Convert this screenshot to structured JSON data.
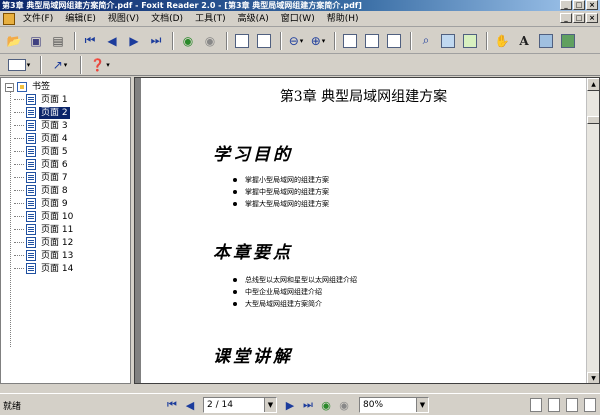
{
  "window": {
    "title": "第3章  典型局域网组建方案简介.pdf - Foxit Reader 2.0 - [第3章  典型局域网组建方案简介.pdf]",
    "btn_min": "_",
    "btn_max": "□",
    "btn_close": "×"
  },
  "menu": {
    "items": [
      "文件(F)",
      "编辑(E)",
      "视图(V)",
      "文档(D)",
      "工具(T)",
      "高级(A)",
      "窗口(W)",
      "帮助(H)"
    ]
  },
  "sidebar": {
    "root_label": "书签",
    "toggle": "−",
    "items": [
      "页面 1",
      "页面 2",
      "页面 3",
      "页面 4",
      "页面 5",
      "页面 6",
      "页面 7",
      "页面 8",
      "页面 9",
      "页面 10",
      "页面 11",
      "页面 12",
      "页面 13",
      "页面 14"
    ],
    "selected_index": 1
  },
  "document": {
    "chapter_title": "第3章  典型局域网组建方案",
    "sections": [
      {
        "heading": "学习目的",
        "bullets": [
          "掌握小型局域网的组建方案",
          "掌握中型局域网的组建方案",
          "掌握大型局域网的组建方案"
        ]
      },
      {
        "heading": "本章要点",
        "bullets": [
          "总线型以太网和星型以太网组建介绍",
          "中型企业局域网组建介绍",
          "大型局域网组建方案简介"
        ]
      },
      {
        "heading": "课堂讲解",
        "bullets": []
      }
    ]
  },
  "status": {
    "text": "就绪",
    "page_value": "2 / 14",
    "zoom_value": "80%"
  }
}
